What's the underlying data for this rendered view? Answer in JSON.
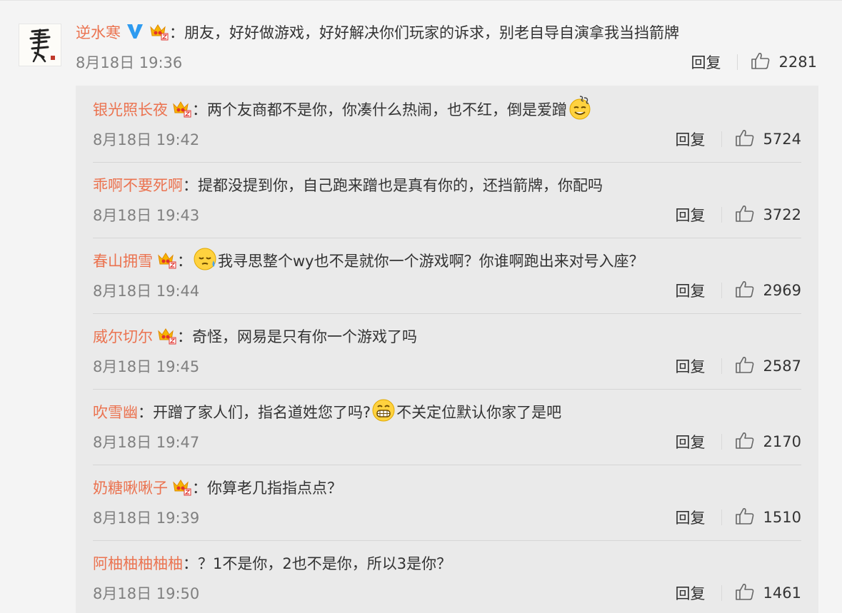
{
  "main_comment": {
    "author": "逆水寒",
    "text": "：朋友，好好做游戏，好好解决你们玩家的诉求，别老自导自演拿我当挡箭牌",
    "time": "8月18日 19:36",
    "reply_label": "回复",
    "likes": "2281"
  },
  "replies": [
    {
      "author": "银光照长夜",
      "text_before": "：两个友商都不是你，你凑什么热闹，也不红，倒是爱蹭",
      "emoji": "sweat-smile-emoji",
      "text_after": "",
      "time": "8月18日 19:42",
      "reply_label": "回复",
      "likes": "5724",
      "badge": true
    },
    {
      "author": "乖啊不要死啊",
      "text_before": "：提都没提到你，自己跑来蹭也是真有你的，还挡箭牌，你配吗",
      "emoji": "",
      "text_after": "",
      "time": "8月18日 19:43",
      "reply_label": "回复",
      "likes": "3722",
      "badge": false
    },
    {
      "author": "春山拥雪",
      "text_before": "：",
      "emoji": "tear-emoji",
      "text_after": "我寻思整个wy也不是就你一个游戏啊？你谁啊跑出来对号入座？",
      "time": "8月18日 19:44",
      "reply_label": "回复",
      "likes": "2969",
      "badge": true
    },
    {
      "author": "威尔切尔",
      "text_before": "：奇怪，网易是只有你一个游戏了吗",
      "emoji": "",
      "text_after": "",
      "time": "8月18日 19:45",
      "reply_label": "回复",
      "likes": "2587",
      "badge": true
    },
    {
      "author": "吹雪幽",
      "text_before": "：开蹭了家人们，指名道姓您了吗?",
      "emoji": "grin-emoji",
      "text_after": "不关定位默认你家了是吧",
      "time": "8月18日 19:47",
      "reply_label": "回复",
      "likes": "2170",
      "badge": false
    },
    {
      "author": "奶糖啾啾子",
      "text_before": "：你算老几指指点点？",
      "emoji": "",
      "text_after": "",
      "time": "8月18日 19:39",
      "reply_label": "回复",
      "likes": "1510",
      "badge": true
    },
    {
      "author": "阿柚柚柚柚柚",
      "text_before": "：？1不是你，2也不是你，所以3是你？",
      "emoji": "",
      "text_after": "",
      "time": "8月18日 19:50",
      "reply_label": "回复",
      "likes": "1461",
      "badge": false
    }
  ],
  "colors": {
    "author": "#eb7350",
    "text": "#333333",
    "meta": "#808080",
    "reply_bg": "#eaeaea",
    "page_bg": "#f4f4f4",
    "verified": "#2e9bf0"
  }
}
